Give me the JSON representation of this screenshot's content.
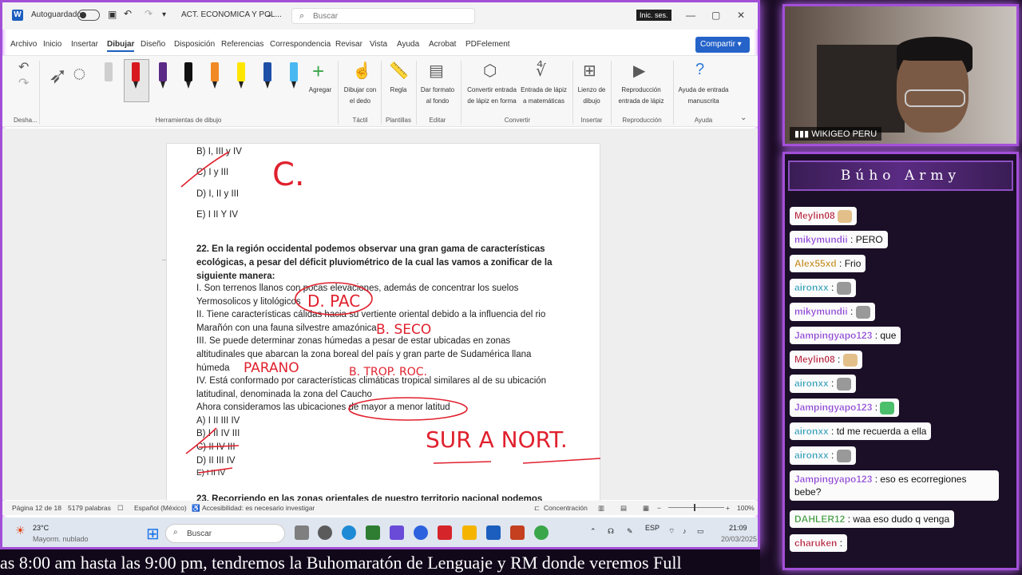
{
  "word": {
    "autosave_label": "Autoguardado",
    "doc_title": "ACT. ECONOMICA Y POL...",
    "search_placeholder": "Buscar",
    "signin_label": "Inic. ses.",
    "menu": [
      "Archivo",
      "Inicio",
      "Insertar",
      "Dibujar",
      "Diseño",
      "Disposición",
      "Referencias",
      "Correspondencia",
      "Revisar",
      "Vista",
      "Ayuda",
      "Acrobat",
      "PDFelement"
    ],
    "active_menu": "Dibujar",
    "share_label": "Compartir",
    "ribbon": {
      "undo_group": "Desha...",
      "draw_tools_group": "Herramientas de dibujo",
      "add_label": "Agregar",
      "draw_touch_label": "Dibujar con el dedo",
      "tactil_group": "Táctil",
      "ruler_label": "Regla",
      "stencils_group": "Plantillas",
      "format_bg_label": "Dar formato al fondo",
      "edit_group": "Editar",
      "ink_to_shape_label": "Convertir entrada de lápiz en forma",
      "ink_to_math_label": "Entrada de lápiz a matemáticas",
      "convert_group": "Convertir",
      "canvas_label": "Lienzo de dibujo",
      "insert_group": "Insertar",
      "replay_label": "Reproducción entrada de lápiz",
      "replay_group": "Reproducción",
      "ink_help_label": "Ayuda de entrada manuscrita",
      "help_group": "Ayuda",
      "pen_colors": [
        "#cfcfcf",
        "#d7191f",
        "#5b2a86",
        "#111111",
        "#f08a24",
        "#ffe600",
        "#1f4fa6",
        "#49b8f0"
      ]
    },
    "document": {
      "lines": [
        {
          "text": "B) I, III y IV",
          "bold": false
        },
        {
          "text": "C) I y III",
          "bold": false
        },
        {
          "text": "D) I, II y III",
          "bold": false
        },
        {
          "text": "E) I II Y IV",
          "bold": false
        },
        {
          "text": "22. En la región occidental podemos observar una gran gama de características",
          "bold": true
        },
        {
          "text": "ecológicas, a pesar del déficit pluviométrico de la cual las vamos a zonificar de la",
          "bold": true
        },
        {
          "text": "siguiente manera:",
          "bold": true
        },
        {
          "text": "I. Son terrenos llanos con pocas elevaciones, además de concentrar los suelos",
          "bold": false
        },
        {
          "text": "Yermosolicos y litológicos",
          "bold": false
        },
        {
          "text": "II. Tiene características cálidas hacia su vertiente oriental debido a la influencia del rio",
          "bold": false
        },
        {
          "text": "Marañón con una fauna silvestre amazónica",
          "bold": false
        },
        {
          "text": "III. Se puede determinar zonas húmedas a pesar de estar ubicadas en zonas",
          "bold": false
        },
        {
          "text": "altitudinales que abarcan la zona boreal del país y gran parte de Sudamérica llana",
          "bold": false
        },
        {
          "text": "húmeda",
          "bold": false
        },
        {
          "text": "IV. Está conformado por características climáticas tropical similares al de su ubicación",
          "bold": false
        },
        {
          "text": "latitudinal, denominada la zona del Caucho",
          "bold": false
        },
        {
          "text": "Ahora consideramos las ubicaciones de mayor a menor latitud",
          "bold": false
        },
        {
          "text": "A) I II III IV",
          "bold": false
        },
        {
          "text": "B) I II IV III",
          "bold": false
        },
        {
          "text": "C) II IV III",
          "bold": false
        },
        {
          "text": "D) II III IV",
          "bold": false
        },
        {
          "text": "E) I II IV",
          "bold": false
        },
        {
          "text": "23. Recorriendo en las zonas orientales de nuestro territorio nacional podemos",
          "bold": true
        }
      ],
      "annotations": {
        "a1": "C.",
        "a2": "D. PAC",
        "a3": "B. SECO",
        "a4": "PARANO",
        "a5": "B. TROP. ROC.",
        "a6": "SUR A NORT."
      }
    },
    "status": {
      "page": "Página 12 de 18",
      "words": "5179 palabras",
      "language": "Español (México)",
      "accessibility": "Accesibilidad: es necesario investigar",
      "focus": "Concentración",
      "zoom": "100%"
    },
    "taskbar": {
      "weather_temp": "23°C",
      "weather_desc": "Mayorm. nublado",
      "search_label": "Buscar",
      "language": "ESP",
      "time": "21:09",
      "date": "20/03/2025"
    }
  },
  "ticker_text": "as 8:00 am hasta las 9:00 pm, tendremos la Buhomaratón de Lenguaje y RM donde veremos Full",
  "webcam": {
    "name": "WIKIGEO PERU"
  },
  "chat": {
    "title": "Búho Army",
    "messages": [
      {
        "user": "Meylin08",
        "text": "",
        "color": "#b5213c",
        "emote": true
      },
      {
        "user": "mikymundii",
        "text": ": PERO",
        "color": "#8a3fd1",
        "emote": false
      },
      {
        "user": "Alex55xd",
        "text": ": Frio",
        "color": "#c28a1e",
        "emote": false
      },
      {
        "user": "aironxx",
        "text": ":",
        "color": "#2f9bb5",
        "emote": true
      },
      {
        "user": "mikymundii",
        "text": ":",
        "color": "#8a3fd1",
        "emote": true
      },
      {
        "user": "Jampingyapo123",
        "text": ": que",
        "color": "#8a3fd1",
        "emote": false
      },
      {
        "user": "Meylin08",
        "text": ":",
        "color": "#b5213c",
        "emote": true
      },
      {
        "user": "aironxx",
        "text": ":",
        "color": "#2f9bb5",
        "emote": true
      },
      {
        "user": "Jampingyapo123",
        "text": ":",
        "color": "#8a3fd1",
        "emote": true
      },
      {
        "user": "aironxx",
        "text": ": td me recuerda a ella",
        "color": "#2f9bb5",
        "emote": false
      },
      {
        "user": "aironxx",
        "text": ":",
        "color": "#2f9bb5",
        "emote": true
      },
      {
        "user": "Jampingyapo123",
        "text": ": eso es ecorregiones bebe?",
        "color": "#8a3fd1",
        "emote": false
      },
      {
        "user": "DAHLER12",
        "text": ": waa eso dudo q venga",
        "color": "#3d9a3d",
        "emote": false
      },
      {
        "user": "charuken",
        "text": ":",
        "color": "#b5213c",
        "emote": false
      }
    ]
  }
}
